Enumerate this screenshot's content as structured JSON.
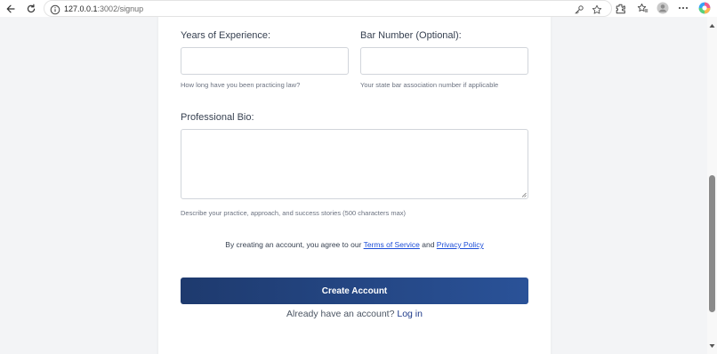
{
  "browser": {
    "url_host": "127.0.0.1",
    "url_rest": ":3002/signup",
    "icons": [
      "back-arrow-icon",
      "reload-icon",
      "info-icon",
      "key-icon",
      "star-icon",
      "extensions-icon",
      "favorites-icon",
      "profile-avatar-icon",
      "more-icon",
      "copilot-icon"
    ]
  },
  "form": {
    "years_label": "Years of Experience:",
    "years_value": "",
    "years_hint": "How long have you been practicing law?",
    "bar_label": "Bar Number (Optional):",
    "bar_value": "",
    "bar_hint": "Your state bar association number if applicable",
    "bio_label": "Professional Bio:",
    "bio_value": "",
    "bio_hint": "Describe your practice, approach, and success stories (500 characters max)",
    "terms_prefix": "By creating an account, you agree to our ",
    "terms_link": "Terms of Service",
    "terms_and": " and ",
    "privacy_link": "Privacy Policy",
    "submit_label": "Create Account",
    "login_prompt": "Already have an account? ",
    "login_link": "Log in"
  },
  "colors": {
    "button_start": "#1e3a6e",
    "button_end": "#2a5298",
    "link": "#1d4ed8",
    "page_bg": "#f3f4f6"
  }
}
